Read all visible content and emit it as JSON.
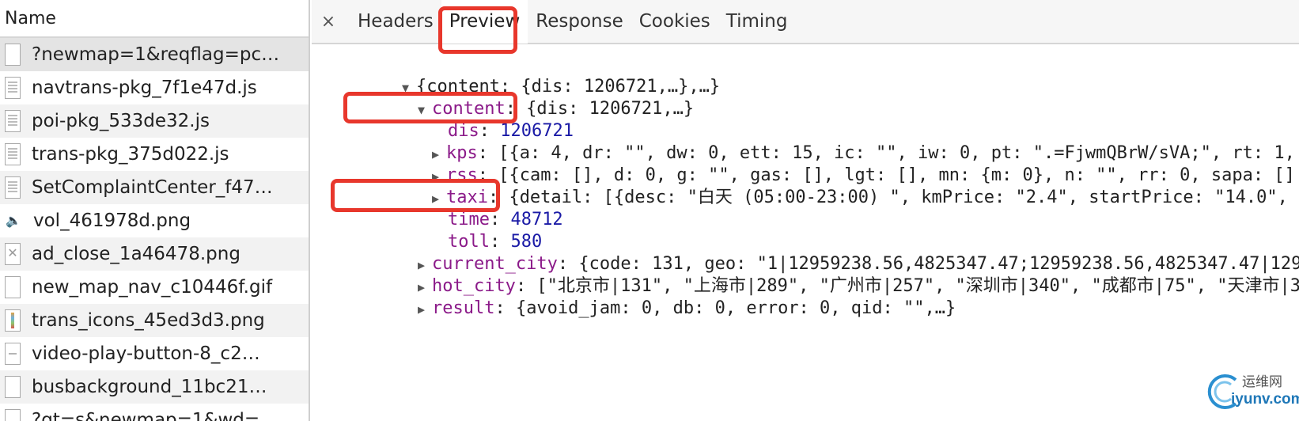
{
  "requests": {
    "header": "Name",
    "items": [
      {
        "name": "?newmap=1&reqflag=pc…",
        "icon": "document-icon"
      },
      {
        "name": "navtrans-pkg_7f1e47d.js",
        "icon": "script-file-icon"
      },
      {
        "name": "poi-pkg_533de32.js",
        "icon": "script-file-icon"
      },
      {
        "name": "trans-pkg_375d022.js",
        "icon": "script-file-icon"
      },
      {
        "name": "SetComplaintCenter_f47…",
        "icon": "script-file-icon"
      },
      {
        "name": "vol_461978d.png",
        "icon": "speaker-image-icon"
      },
      {
        "name": "ad_close_1a46478.png",
        "icon": "close-image-icon"
      },
      {
        "name": "new_map_nav_c10446f.gif",
        "icon": "document-icon"
      },
      {
        "name": "trans_icons_45ed3d3.png",
        "icon": "sprite-image-icon"
      },
      {
        "name": "video-play-button-8_c2…",
        "icon": "dash-image-icon"
      },
      {
        "name": "busbackground_11bc21…",
        "icon": "document-icon"
      },
      {
        "name": "?qt=s&newmap=1&wd=…",
        "icon": "document-icon"
      }
    ]
  },
  "tabs": {
    "close_glyph": "×",
    "items": [
      "Headers",
      "Preview",
      "Response",
      "Cookies",
      "Timing"
    ],
    "active": "Preview"
  },
  "preview": {
    "root": "{content: {dis: 1206721,…},…}",
    "content_key": "content",
    "content_summary": ": {dis: 1206721,…}",
    "dis_key": "dis",
    "dis_value": "1206721",
    "kps_key": "kps",
    "kps_value": ": [{a: 4, dr: \"\", dw: 0, ett: 15, ic: \"\", iw: 0, pt: \".=FjwmQBrW/sVA;\", rt: 1,",
    "rss_key": "rss",
    "rss_value": ": [{cam: [], d: 0, g: \"\", gas: [], lgt: [], mn: {m: 0}, n: \"\", rr: 0, sapa: []",
    "taxi_key": "taxi",
    "taxi_value": ": {detail: [{desc: \"白天 (05:00-23:00) \", kmPrice: \"2.4\", startPrice: \"14.0\", t",
    "time_key": "time",
    "time_value": "48712",
    "toll_key": "toll",
    "toll_value": "580",
    "current_city_key": "current_city",
    "current_city_value": ": {code: 131, geo: \"1|12959238.56,4825347.47;12959238.56,4825347.47|129",
    "hot_city_key": "hot_city",
    "hot_city_value": ": [\"北京市|131\", \"上海市|289\", \"广州市|257\", \"深圳市|340\", \"成都市|75\", \"天津市|3",
    "result_key": "result",
    "result_value": ": {avoid_jam: 0, db: 0, error: 0, qid: \"\",…}"
  },
  "watermark": {
    "chinese": "运维网",
    "url": "iyunv.com"
  },
  "colors": {
    "highlight": "#e8372c",
    "key": "#8b1a89",
    "number": "#1a1aa6"
  }
}
